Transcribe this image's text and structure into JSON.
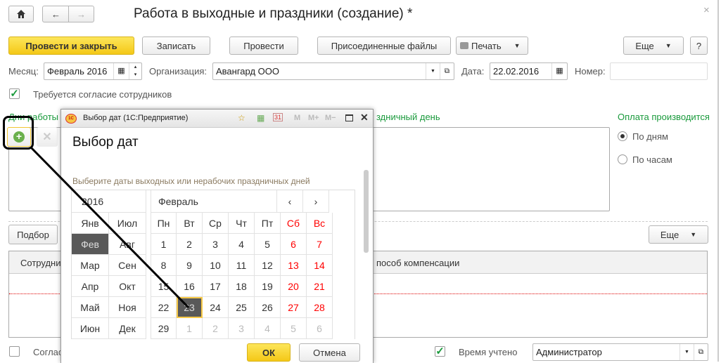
{
  "window": {
    "title": "Работа в выходные и праздники (создание) *",
    "close": "×"
  },
  "toolbar": {
    "post_close": "Провести и закрыть",
    "save": "Записать",
    "post": "Провести",
    "files": "Присоединенные файлы",
    "print": "Печать",
    "more": "Еще",
    "help": "?"
  },
  "fields": {
    "month_label": "Месяц:",
    "month_value": "Февраль 2016",
    "org_label": "Организация:",
    "org_value": "Авангард ООО",
    "date_label": "Дата:",
    "date_value": "22.02.2016",
    "number_label": "Номер:",
    "number_value": ""
  },
  "consent_required": {
    "label": "Требуется согласие сотрудников",
    "checked": true
  },
  "days_section": {
    "label": "Дни работы",
    "label_tail": "здничный день"
  },
  "payment": {
    "title": "Оплата производится",
    "options": [
      "По дням",
      "По часам"
    ],
    "selected": 0
  },
  "table": {
    "pick": "Подбор",
    "more": "Еще",
    "col1": "Сотрудни",
    "col2": "пособ компенсации"
  },
  "footer": {
    "consent_label": "Соглас",
    "time_label": "Время учтено",
    "time_checked": true,
    "responsible": "Администратор"
  },
  "dialog": {
    "title": "Выбор дат  (1С:Предприятие)",
    "tb_m": "M",
    "tb_mplus": "M+",
    "tb_mminus": "M−",
    "heading": "Выбор дат",
    "hint": "Выберите даты выходных или нерабочих праздничных дней",
    "year": "2016",
    "month": "Февраль",
    "prev": "‹",
    "next": "›",
    "ok": "ОК",
    "cancel": "Отмена",
    "months": [
      [
        "Янв",
        "Июл"
      ],
      [
        "Фев",
        "Авг"
      ],
      [
        "Мар",
        "Сен"
      ],
      [
        "Апр",
        "Окт"
      ],
      [
        "Май",
        "Ноя"
      ],
      [
        "Июн",
        "Дек"
      ]
    ],
    "selected_month": "Фев",
    "weekdays": [
      "Пн",
      "Вт",
      "Ср",
      "Чт",
      "Пт",
      "Сб",
      "Вс"
    ],
    "weeks": [
      [
        "1",
        "2",
        "3",
        "4",
        "5",
        "6",
        "7"
      ],
      [
        "8",
        "9",
        "10",
        "11",
        "12",
        "13",
        "14"
      ],
      [
        "15",
        "16",
        "17",
        "18",
        "19",
        "20",
        "21"
      ],
      [
        "22",
        "23",
        "24",
        "25",
        "26",
        "27",
        "28"
      ],
      [
        "29",
        "1",
        "2",
        "3",
        "4",
        "5",
        "6"
      ]
    ],
    "selected_day": "23"
  },
  "colors": {
    "accent": "#f4c817",
    "green": "#1a9a3c",
    "weekend": "#ff0000"
  }
}
